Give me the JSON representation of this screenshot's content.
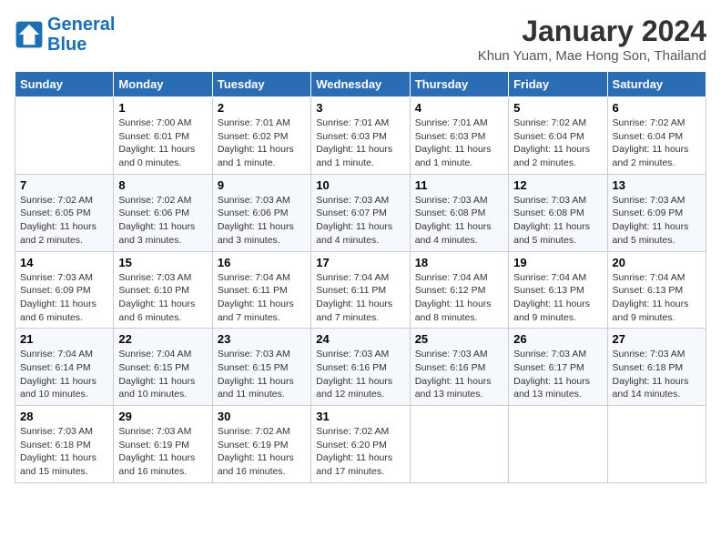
{
  "header": {
    "logo_line1": "General",
    "logo_line2": "Blue",
    "month_title": "January 2024",
    "location": "Khun Yuam, Mae Hong Son, Thailand"
  },
  "columns": [
    "Sunday",
    "Monday",
    "Tuesday",
    "Wednesday",
    "Thursday",
    "Friday",
    "Saturday"
  ],
  "weeks": [
    [
      {
        "day": "",
        "info": ""
      },
      {
        "day": "1",
        "info": "Sunrise: 7:00 AM\nSunset: 6:01 PM\nDaylight: 11 hours\nand 0 minutes."
      },
      {
        "day": "2",
        "info": "Sunrise: 7:01 AM\nSunset: 6:02 PM\nDaylight: 11 hours\nand 1 minute."
      },
      {
        "day": "3",
        "info": "Sunrise: 7:01 AM\nSunset: 6:03 PM\nDaylight: 11 hours\nand 1 minute."
      },
      {
        "day": "4",
        "info": "Sunrise: 7:01 AM\nSunset: 6:03 PM\nDaylight: 11 hours\nand 1 minute."
      },
      {
        "day": "5",
        "info": "Sunrise: 7:02 AM\nSunset: 6:04 PM\nDaylight: 11 hours\nand 2 minutes."
      },
      {
        "day": "6",
        "info": "Sunrise: 7:02 AM\nSunset: 6:04 PM\nDaylight: 11 hours\nand 2 minutes."
      }
    ],
    [
      {
        "day": "7",
        "info": "Sunrise: 7:02 AM\nSunset: 6:05 PM\nDaylight: 11 hours\nand 2 minutes."
      },
      {
        "day": "8",
        "info": "Sunrise: 7:02 AM\nSunset: 6:06 PM\nDaylight: 11 hours\nand 3 minutes."
      },
      {
        "day": "9",
        "info": "Sunrise: 7:03 AM\nSunset: 6:06 PM\nDaylight: 11 hours\nand 3 minutes."
      },
      {
        "day": "10",
        "info": "Sunrise: 7:03 AM\nSunset: 6:07 PM\nDaylight: 11 hours\nand 4 minutes."
      },
      {
        "day": "11",
        "info": "Sunrise: 7:03 AM\nSunset: 6:08 PM\nDaylight: 11 hours\nand 4 minutes."
      },
      {
        "day": "12",
        "info": "Sunrise: 7:03 AM\nSunset: 6:08 PM\nDaylight: 11 hours\nand 5 minutes."
      },
      {
        "day": "13",
        "info": "Sunrise: 7:03 AM\nSunset: 6:09 PM\nDaylight: 11 hours\nand 5 minutes."
      }
    ],
    [
      {
        "day": "14",
        "info": "Sunrise: 7:03 AM\nSunset: 6:09 PM\nDaylight: 11 hours\nand 6 minutes."
      },
      {
        "day": "15",
        "info": "Sunrise: 7:03 AM\nSunset: 6:10 PM\nDaylight: 11 hours\nand 6 minutes."
      },
      {
        "day": "16",
        "info": "Sunrise: 7:04 AM\nSunset: 6:11 PM\nDaylight: 11 hours\nand 7 minutes."
      },
      {
        "day": "17",
        "info": "Sunrise: 7:04 AM\nSunset: 6:11 PM\nDaylight: 11 hours\nand 7 minutes."
      },
      {
        "day": "18",
        "info": "Sunrise: 7:04 AM\nSunset: 6:12 PM\nDaylight: 11 hours\nand 8 minutes."
      },
      {
        "day": "19",
        "info": "Sunrise: 7:04 AM\nSunset: 6:13 PM\nDaylight: 11 hours\nand 9 minutes."
      },
      {
        "day": "20",
        "info": "Sunrise: 7:04 AM\nSunset: 6:13 PM\nDaylight: 11 hours\nand 9 minutes."
      }
    ],
    [
      {
        "day": "21",
        "info": "Sunrise: 7:04 AM\nSunset: 6:14 PM\nDaylight: 11 hours\nand 10 minutes."
      },
      {
        "day": "22",
        "info": "Sunrise: 7:04 AM\nSunset: 6:15 PM\nDaylight: 11 hours\nand 10 minutes."
      },
      {
        "day": "23",
        "info": "Sunrise: 7:03 AM\nSunset: 6:15 PM\nDaylight: 11 hours\nand 11 minutes."
      },
      {
        "day": "24",
        "info": "Sunrise: 7:03 AM\nSunset: 6:16 PM\nDaylight: 11 hours\nand 12 minutes."
      },
      {
        "day": "25",
        "info": "Sunrise: 7:03 AM\nSunset: 6:16 PM\nDaylight: 11 hours\nand 13 minutes."
      },
      {
        "day": "26",
        "info": "Sunrise: 7:03 AM\nSunset: 6:17 PM\nDaylight: 11 hours\nand 13 minutes."
      },
      {
        "day": "27",
        "info": "Sunrise: 7:03 AM\nSunset: 6:18 PM\nDaylight: 11 hours\nand 14 minutes."
      }
    ],
    [
      {
        "day": "28",
        "info": "Sunrise: 7:03 AM\nSunset: 6:18 PM\nDaylight: 11 hours\nand 15 minutes."
      },
      {
        "day": "29",
        "info": "Sunrise: 7:03 AM\nSunset: 6:19 PM\nDaylight: 11 hours\nand 16 minutes."
      },
      {
        "day": "30",
        "info": "Sunrise: 7:02 AM\nSunset: 6:19 PM\nDaylight: 11 hours\nand 16 minutes."
      },
      {
        "day": "31",
        "info": "Sunrise: 7:02 AM\nSunset: 6:20 PM\nDaylight: 11 hours\nand 17 minutes."
      },
      {
        "day": "",
        "info": ""
      },
      {
        "day": "",
        "info": ""
      },
      {
        "day": "",
        "info": ""
      }
    ]
  ]
}
